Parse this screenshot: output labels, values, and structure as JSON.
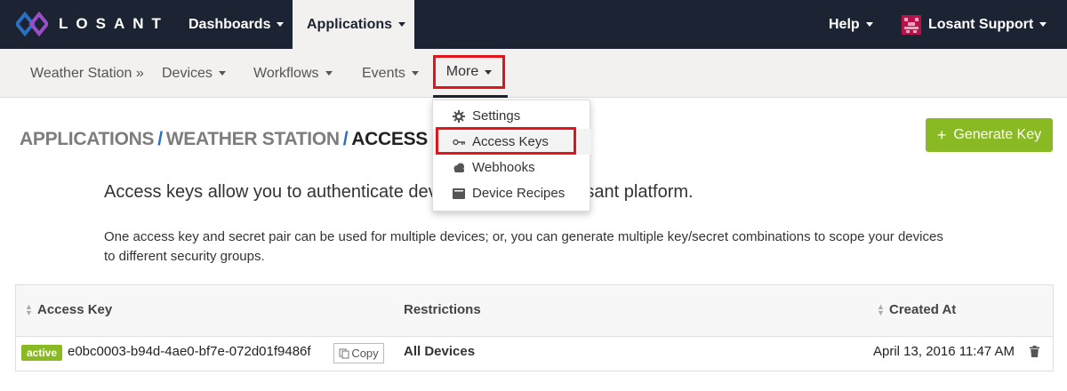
{
  "brand": {
    "name": "LOSANT"
  },
  "topnav": {
    "dashboards": "Dashboards",
    "applications": "Applications",
    "help": "Help",
    "user": "Losant Support"
  },
  "subnav": {
    "app_name": "Weather Station »",
    "devices": "Devices",
    "workflows": "Workflows",
    "events": "Events",
    "more": "More"
  },
  "more_menu": {
    "items": [
      {
        "label": "Settings",
        "icon": "gear-icon"
      },
      {
        "label": "Access Keys",
        "icon": "key-icon"
      },
      {
        "label": "Webhooks",
        "icon": "cloud-icon"
      },
      {
        "label": "Device Recipes",
        "icon": "book-icon"
      }
    ]
  },
  "breadcrumb": {
    "applications": "APPLICATIONS",
    "sep": "/",
    "app": "WEATHER STATION",
    "current": "ACCESS KEYS"
  },
  "generate_button": {
    "plus": "+",
    "label": "Generate Key"
  },
  "content": {
    "lead": "Access keys allow you to authenticate devices against the Losant platform.",
    "description": "One access key and secret pair can be used for multiple devices; or, you can generate multiple key/secret combinations to scope your devices to different security groups."
  },
  "table": {
    "headers": {
      "access_key": "Access Key",
      "restrictions": "Restrictions",
      "created_at": "Created At"
    },
    "rows": [
      {
        "status": "active",
        "key": "e0bc0003-b94d-4ae0-bf7e-072d01f9486f",
        "copy_label": "Copy",
        "restrictions": "All Devices",
        "created": "April 13, 2016 11:47 AM"
      }
    ]
  },
  "colors": {
    "nav_bg": "#1c2333",
    "subnav_bg": "#f2f1ef",
    "accent_green": "#89ba24",
    "link_blue": "#2b6fc1",
    "highlight_red": "#e2151b"
  }
}
